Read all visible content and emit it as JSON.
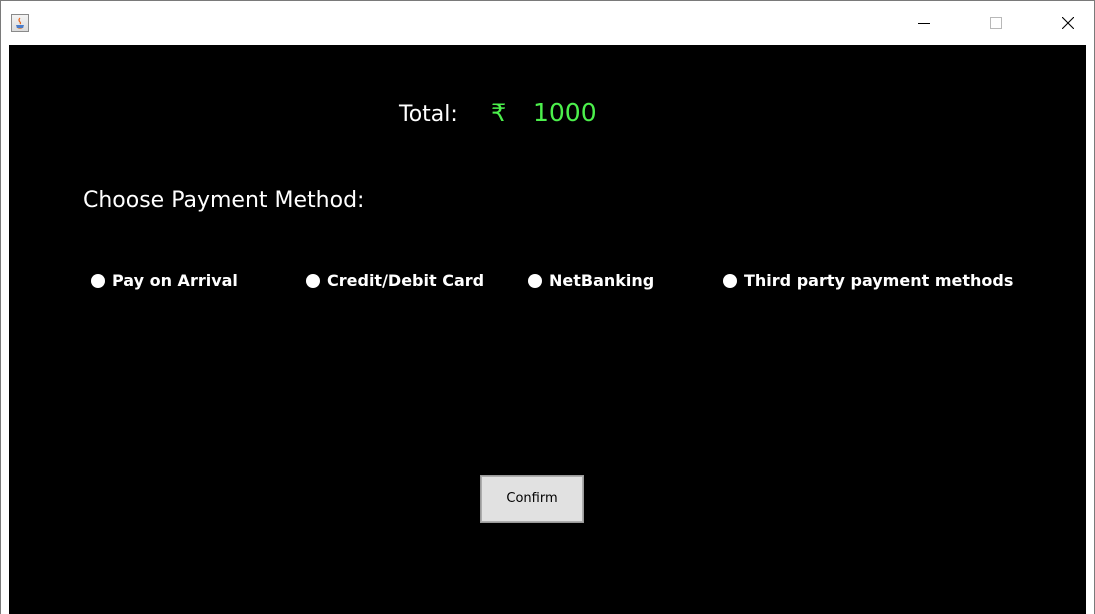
{
  "window": {
    "title": "",
    "controls": {
      "minimize": "minimize-icon",
      "maximize": "maximize-icon",
      "close": "close-icon"
    }
  },
  "total": {
    "label": "Total:",
    "currency": "₹",
    "amount": "1000"
  },
  "payment": {
    "heading": "Choose Payment Method:",
    "options": [
      {
        "label": "Pay on Arrival",
        "selected": false
      },
      {
        "label": "Credit/Debit Card",
        "selected": false
      },
      {
        "label": "NetBanking",
        "selected": false
      },
      {
        "label": "Third party payment methods",
        "selected": false
      }
    ]
  },
  "actions": {
    "confirm_label": "Confirm"
  },
  "colors": {
    "background": "#000000",
    "amount": "#4cf04c",
    "text": "#ffffff"
  }
}
